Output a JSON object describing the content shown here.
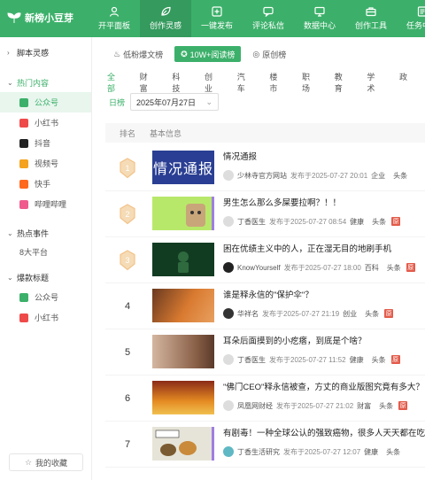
{
  "app": {
    "name": "新榜小豆芽"
  },
  "nav": [
    {
      "label": "开平面板",
      "icon": "user-icon"
    },
    {
      "label": "创作灵感",
      "icon": "leaf-icon"
    },
    {
      "label": "一键发布",
      "icon": "plus-square-icon"
    },
    {
      "label": "评论私信",
      "icon": "comment-icon"
    },
    {
      "label": "数据中心",
      "icon": "monitor-icon"
    },
    {
      "label": "创作工具",
      "icon": "briefcase-icon"
    },
    {
      "label": "任务中心",
      "icon": "list-icon"
    }
  ],
  "sidebar": {
    "sections": {
      "s1": "脚本灵感",
      "s2": "热门内容",
      "s3": "热点事件",
      "s4": "爆款标题"
    },
    "hot_items": [
      {
        "label": "公众号",
        "color": "#3cb06a"
      },
      {
        "label": "小红书",
        "color": "#ef4a4a"
      },
      {
        "label": "抖音",
        "color": "#222222"
      },
      {
        "label": "视频号",
        "color": "#f4a21f"
      },
      {
        "label": "快手",
        "color": "#ff6a1f"
      },
      {
        "label": "哔哩哔哩",
        "color": "#ef5b8c"
      }
    ],
    "event_items": [
      "8大平台"
    ],
    "title_items": [
      {
        "label": "公众号",
        "color": "#3cb06a"
      },
      {
        "label": "小红书",
        "color": "#ef4a4a"
      }
    ],
    "collect": "我的收藏"
  },
  "rank_tabs": [
    "低粉爆文榜",
    "10W+阅读榜",
    "原创榜"
  ],
  "categories": [
    "全部",
    "财富",
    "科技",
    "创业",
    "汽车",
    "楼市",
    "职场",
    "教育",
    "学术",
    "政"
  ],
  "date": {
    "label": "日榜",
    "value": "2025年07月27日"
  },
  "table_head": {
    "rank": "排名",
    "info": "基本信息"
  },
  "rows": [
    {
      "rank": "1",
      "title": "情况通报",
      "thumb_text": "情况通报",
      "account": "少林寺官方网站",
      "published": "发布于2025-07-27 20:01",
      "category": "企业",
      "tag": "头条",
      "original": false
    },
    {
      "rank": "2",
      "title": "男生怎么那么多屎要拉啊？！！",
      "thumb_text": "",
      "account": "丁香医生",
      "published": "发布于2025-07-27 08:54",
      "category": "健康",
      "tag": "头条",
      "original": true
    },
    {
      "rank": "3",
      "title": "困在优绩主义中的人，正在湿无目的地刷手机",
      "thumb_text": "",
      "account": "KnowYourself",
      "published": "发布于2025-07-27 18:00",
      "category": "百科",
      "tag": "头条",
      "original": true
    },
    {
      "rank": "4",
      "title": "谁是释永信的\"保护伞\"？",
      "thumb_text": "",
      "account": "华祥名",
      "published": "发布于2025-07-27 21:19",
      "category": "创业",
      "tag": "头条",
      "original": true
    },
    {
      "rank": "5",
      "title": "耳朵后面摸到的小疙瘩，到底是个啥？",
      "thumb_text": "",
      "account": "丁香医生",
      "published": "发布于2025-07-27 11:52",
      "category": "健康",
      "tag": "头条",
      "original": true
    },
    {
      "rank": "6",
      "title": "\"佛门CEO\"释永信被查，方丈的商业版图究竟有多大？",
      "thumb_text": "",
      "account": "凤凰网财经",
      "published": "发布于2025-07-27 21:02",
      "category": "财富",
      "tag": "头条",
      "original": true
    },
    {
      "rank": "7",
      "title": "有剧毒！一种全球公认的强致癌物，很多人天天都在吃",
      "thumb_text": "",
      "account": "丁香生活研究",
      "published": "发布于2025-07-27 12:07",
      "category": "健康",
      "tag": "头条",
      "original": false
    }
  ],
  "orig_badge": "原",
  "colors": {
    "brand": "#3cb06a",
    "medal": "#f2c388",
    "original": "#e35b4a"
  }
}
